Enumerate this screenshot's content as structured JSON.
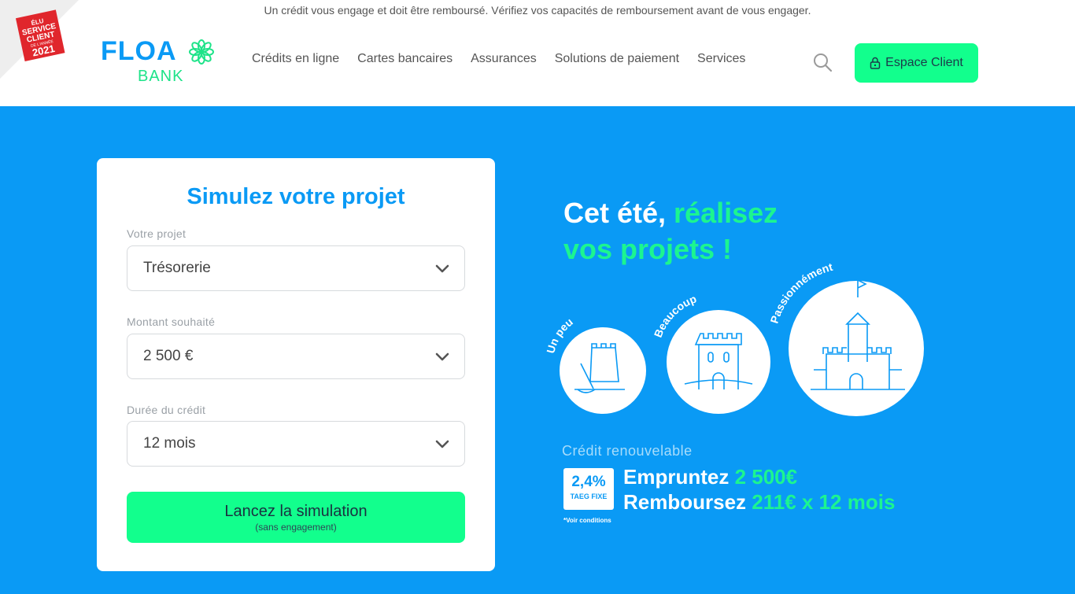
{
  "header": {
    "disclaimer": "Un crédit vous engage et doit être remboursé. Vérifiez vos capacités de remboursement avant de vous engager.",
    "badge": {
      "line1": "ÉLU",
      "line2": "SERVICE",
      "line3": "CLIENT",
      "line4": "DE L'ANNÉE",
      "year": "2021"
    },
    "logo": {
      "brand": "FLOA",
      "sub": "BANK"
    },
    "nav": [
      "Crédits en ligne",
      "Cartes bancaires",
      "Assurances",
      "Solutions de paiement",
      "Services"
    ],
    "espace_client": "Espace Client"
  },
  "form": {
    "title": "Simulez votre projet",
    "projet_label": "Votre projet",
    "projet_value": "Trésorerie",
    "montant_label": "Montant souhaité",
    "montant_value": "2 500 €",
    "duree_label": "Durée du crédit",
    "duree_value": "12 mois",
    "submit_label": "Lancez la simulation",
    "submit_sub": "(sans engagement)"
  },
  "promo": {
    "title_white": "Cet été, ",
    "title_green1": "réalisez",
    "title_green2": "vos projets !",
    "circles": [
      "Un peu",
      "Beaucoup",
      "Passionnément"
    ],
    "product": "Crédit renouvelable",
    "taeg_rate": "2,4%",
    "taeg_label": "TAEG FIXE",
    "conditions": "*Voir conditions",
    "line1_white": "Empruntez ",
    "line1_green": "2 500€",
    "line2_white": "Remboursez ",
    "line2_green": "211€ x 12 mois"
  },
  "colors": {
    "primary_blue": "#0a9af5",
    "accent_green": "#12ff8d",
    "badge_red": "#e0262c"
  }
}
